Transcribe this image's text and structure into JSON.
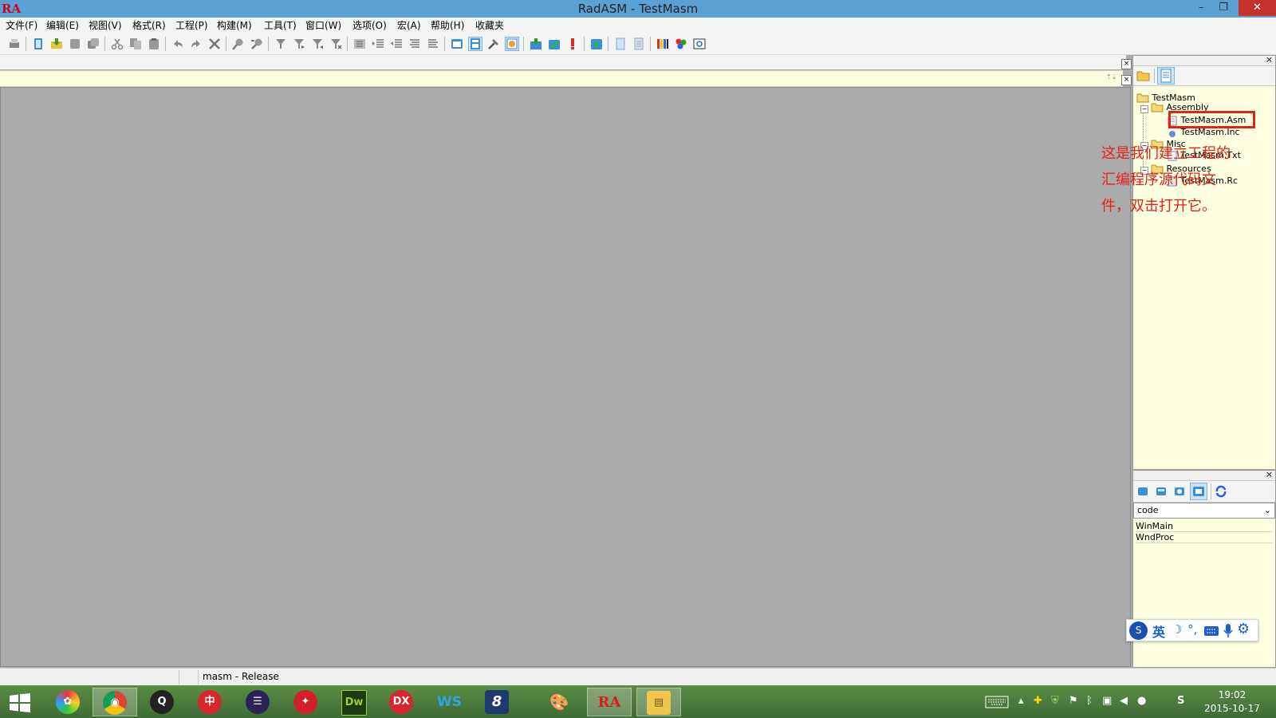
{
  "window": {
    "title": "RadASM - TestMasm",
    "logo": "RA",
    "minimize": "–",
    "restore": "❐",
    "close": "✕"
  },
  "menu": [
    "文件(F)",
    "编辑(E)",
    "视图(V)",
    "格式(R)",
    "工程(P)",
    "构建(M)",
    "工具(T)",
    "窗口(W)",
    "选项(O)",
    "宏(A)",
    "帮助(H)",
    "收藏夹"
  ],
  "project": {
    "root": "TestMasm",
    "groups": [
      {
        "name": "Assembly",
        "files": [
          "TestMasm.Asm",
          "TestMasm.Inc"
        ]
      },
      {
        "name": "Misc",
        "files": [
          "TestMasm.Txt"
        ]
      },
      {
        "name": "Resources",
        "files": [
          "TestMasm.Rc"
        ]
      }
    ]
  },
  "properties": {
    "selected": "code",
    "items": [
      "WinMain",
      "WndProc"
    ]
  },
  "annotation": {
    "lines": [
      "这是我们建立工程的",
      "汇编程序源代码文",
      "件，双击打开它。"
    ]
  },
  "status": {
    "build": "masm - Release"
  },
  "ime": {
    "mode": "英",
    "icons": [
      "ime-logo-icon",
      "moon-icon",
      "punctuation-icon",
      "keyboard-icon",
      "mic-icon",
      "settings-icon"
    ]
  },
  "taskbar": {
    "apps": [
      {
        "name": "start-button",
        "glyph": "⊞"
      },
      {
        "name": "app-pinwheel",
        "glyph": "✿"
      },
      {
        "name": "app-chrome",
        "glyph": "◉"
      },
      {
        "name": "app-qq",
        "glyph": "Q"
      },
      {
        "name": "app-bank",
        "glyph": "中"
      },
      {
        "name": "app-eclipse",
        "glyph": "☰"
      },
      {
        "name": "app-sword",
        "glyph": "✦"
      },
      {
        "name": "app-dreamweaver",
        "glyph": "Dw"
      },
      {
        "name": "app-dx",
        "glyph": "DX"
      },
      {
        "name": "app-ws",
        "glyph": "WS"
      },
      {
        "name": "app-8",
        "glyph": "8"
      },
      {
        "name": "app-paint",
        "glyph": "🎨"
      },
      {
        "name": "app-radasm",
        "glyph": "RA"
      },
      {
        "name": "app-explorer",
        "glyph": "▤"
      }
    ],
    "time": "19:02",
    "date": "2015-10-17"
  },
  "colors": {
    "titlebar": "#5aa0d2",
    "close": "#c7312b",
    "highlight": "#e2221a",
    "panel": "#ffffe1"
  }
}
